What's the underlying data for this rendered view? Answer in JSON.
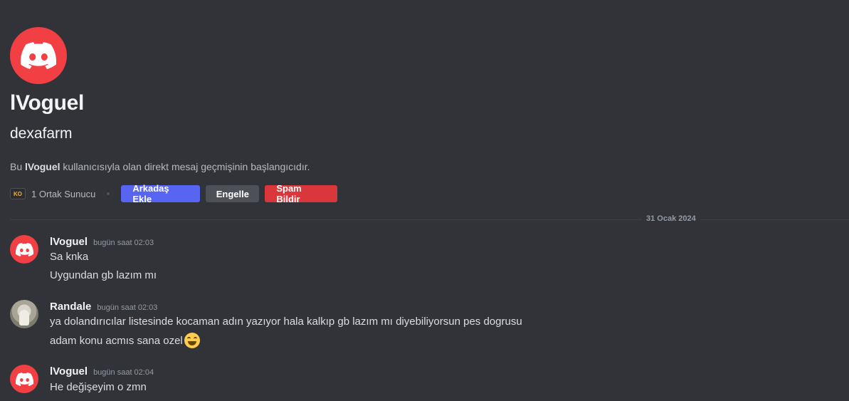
{
  "profile": {
    "display_name": "lVoguel",
    "username": "dexafarm",
    "intro_prefix": "Bu ",
    "intro_name": "lVoguel",
    "intro_suffix": " kullanıcısıyla olan direkt mesaj geçmişinin başlangıcıdır.",
    "mutual_servers": "1 Ortak Sunucu",
    "server_icon_label": "KO"
  },
  "actions": {
    "add_friend": "Arkadaş Ekle",
    "block": "Engelle",
    "report_spam": "Spam Bildir"
  },
  "divider": {
    "date": "31 Ocak 2024"
  },
  "colors": {
    "background": "#313338",
    "discord_red": "#f23f43",
    "blurple": "#5865f2",
    "danger": "#da373c"
  },
  "messages": [
    {
      "author": "lVoguel",
      "timestamp": "bugün saat 02:03",
      "avatar_icon": "discord-logo-icon",
      "lines": [
        "Sa knka",
        "Uygundan gb lazım mı"
      ]
    },
    {
      "author": "Randale",
      "timestamp": "bugün saat 02:03",
      "avatar_icon": "user-photo",
      "lines": [
        "ya dolandırıcılar listesinde kocaman adın yazıyor hala kalkıp gb lazım mı diyebiliyorsun pes dogrusu",
        "adam konu acmıs sana ozel"
      ],
      "emoji": "grinning-face-icon"
    },
    {
      "author": "lVoguel",
      "timestamp": "bugün saat 02:04",
      "avatar_icon": "discord-logo-icon",
      "lines": [
        "He değişeyim o zmn"
      ]
    }
  ]
}
